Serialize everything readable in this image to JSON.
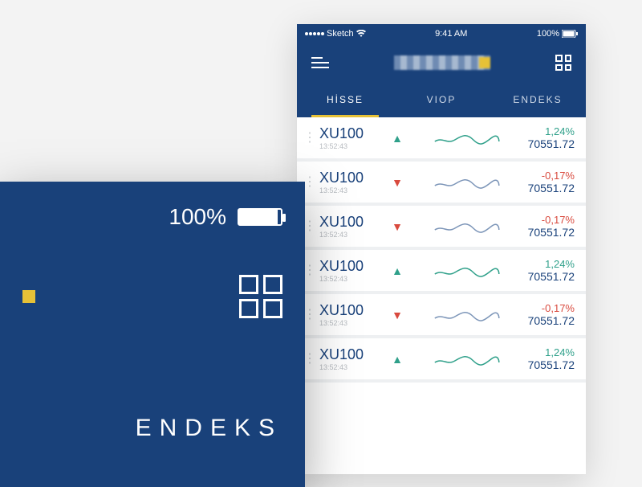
{
  "status": {
    "carrier": "Sketch",
    "time": "9:41 AM",
    "battery": "100%"
  },
  "tabs": [
    "HİSSE",
    "VIOP",
    "ENDEKS"
  ],
  "active_tab": 0,
  "rows": [
    {
      "symbol": "XU100",
      "time": "13:52:43",
      "dir": "up",
      "pct": "1,24%",
      "value": "70551.72"
    },
    {
      "symbol": "XU100",
      "time": "13:52:43",
      "dir": "down",
      "pct": "-0,17%",
      "value": "70551.72"
    },
    {
      "symbol": "XU100",
      "time": "13:52:43",
      "dir": "down",
      "pct": "-0,17%",
      "value": "70551.72"
    },
    {
      "symbol": "XU100",
      "time": "13:52:43",
      "dir": "up",
      "pct": "1,24%",
      "value": "70551.72"
    },
    {
      "symbol": "XU100",
      "time": "13:52:43",
      "dir": "down",
      "pct": "-0,17%",
      "value": "70551.72"
    },
    {
      "symbol": "XU100",
      "time": "13:52:43",
      "dir": "up",
      "pct": "1,24%",
      "value": "70551.72"
    }
  ],
  "zoom": {
    "battery": "100%",
    "tab_label": "ENDEKS"
  }
}
